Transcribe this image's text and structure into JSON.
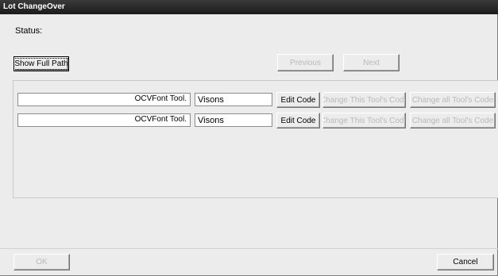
{
  "window": {
    "title": "Lot ChangeOver"
  },
  "status": {
    "label": "Status:"
  },
  "toolbar": {
    "show_full_path_label": "Show Full Path",
    "previous_label": "Previous",
    "next_label": "Next"
  },
  "tools": [
    {
      "path": "OCVFont Tool.",
      "name": "Visons",
      "edit_label": "Edit Code",
      "change_this_label": "Change This Tool's Code",
      "change_all_label": "Change all Tool's Code"
    },
    {
      "path": "OCVFont Tool.",
      "name": "Visons",
      "edit_label": "Edit Code",
      "change_this_label": "Change This Tool's Code",
      "change_all_label": "Change all Tool's Code"
    }
  ],
  "footer": {
    "ok_label": "OK",
    "cancel_label": "Cancel"
  }
}
